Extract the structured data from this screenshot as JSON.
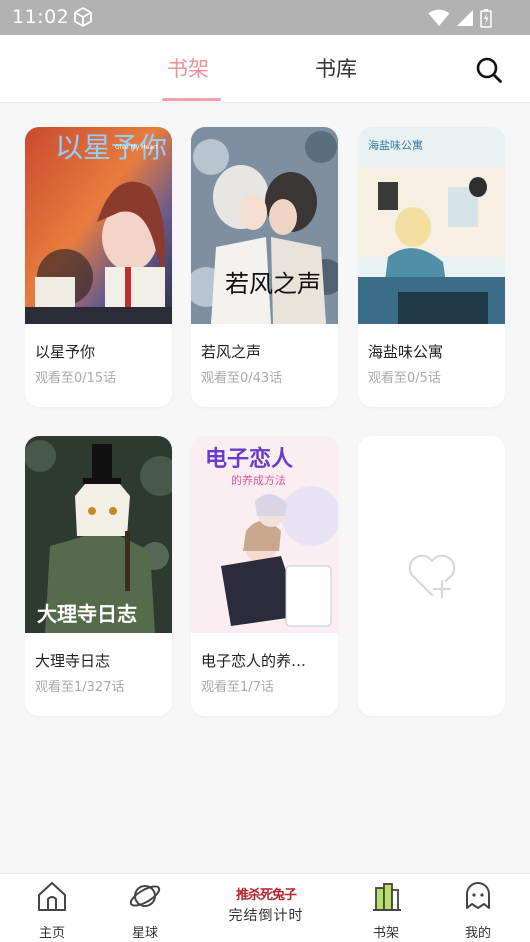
{
  "status_bar": {
    "time": "11:02"
  },
  "header": {
    "tabs": [
      {
        "label": "书架",
        "active": true
      },
      {
        "label": "书库",
        "active": false
      }
    ]
  },
  "books": [
    {
      "title": "以星予你",
      "progress": "观看至0/15话"
    },
    {
      "title": "若风之声",
      "progress": "观看至0/43话"
    },
    {
      "title": "海盐味公寓",
      "progress": "观看至0/5话"
    },
    {
      "title": "大理寺日志",
      "progress": "观看至1/327话"
    },
    {
      "title": "电子恋人的养…",
      "progress": "观看至1/7话"
    }
  ],
  "covers": [
    {
      "text": "以星予你",
      "small": "Give My Heart"
    },
    {
      "text": "若风之声"
    },
    {
      "text": "海盐味公寓"
    },
    {
      "text": "大理寺日志"
    },
    {
      "text": "电子恋人",
      "sub": "的养成方法"
    }
  ],
  "bottom_nav": {
    "home": "主页",
    "planet": "星球",
    "promo_top": "推杀死兔子",
    "promo_bottom": "完结倒计时",
    "shelf": "书架",
    "mine": "我的"
  },
  "colors": {
    "accent": "#f09199",
    "status_bar": "#b2b2b2",
    "page_bg": "#f7f7f7"
  }
}
